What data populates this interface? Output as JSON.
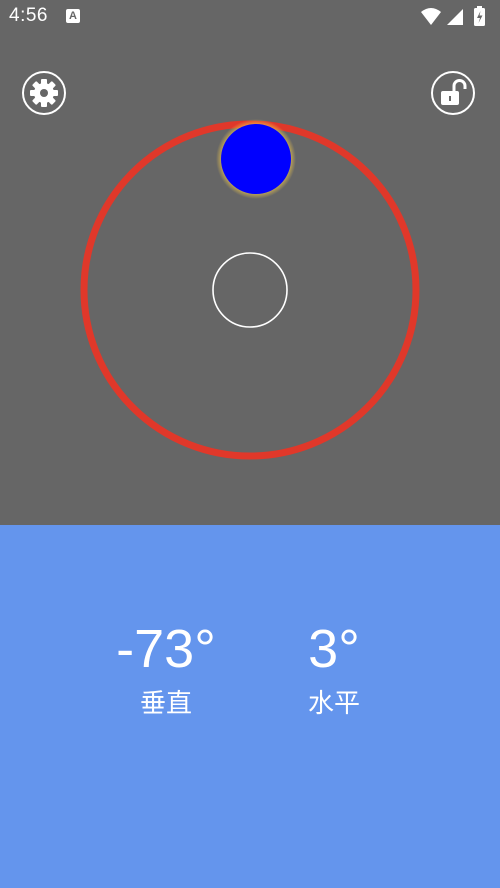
{
  "status_bar": {
    "time": "4:56",
    "notification_letter": "A",
    "icons": [
      "wifi-icon",
      "cellular-signal-icon",
      "battery-charging-icon"
    ]
  },
  "toolbar": {
    "settings_icon": "gear-icon",
    "lock_icon": "unlocked-padlock-icon"
  },
  "level": {
    "ring_color": "#e0382a",
    "bubble_color": "#0000ff",
    "bubble_glow_color": "#f2c94c",
    "center_target_color": "#ffffff"
  },
  "readings": {
    "vertical": {
      "value": "-73°",
      "label": "垂直"
    },
    "horizontal": {
      "value": "3°",
      "label": "水平"
    }
  },
  "colors": {
    "background": "#666666",
    "panel": "#6495ed",
    "text": "#ffffff"
  }
}
